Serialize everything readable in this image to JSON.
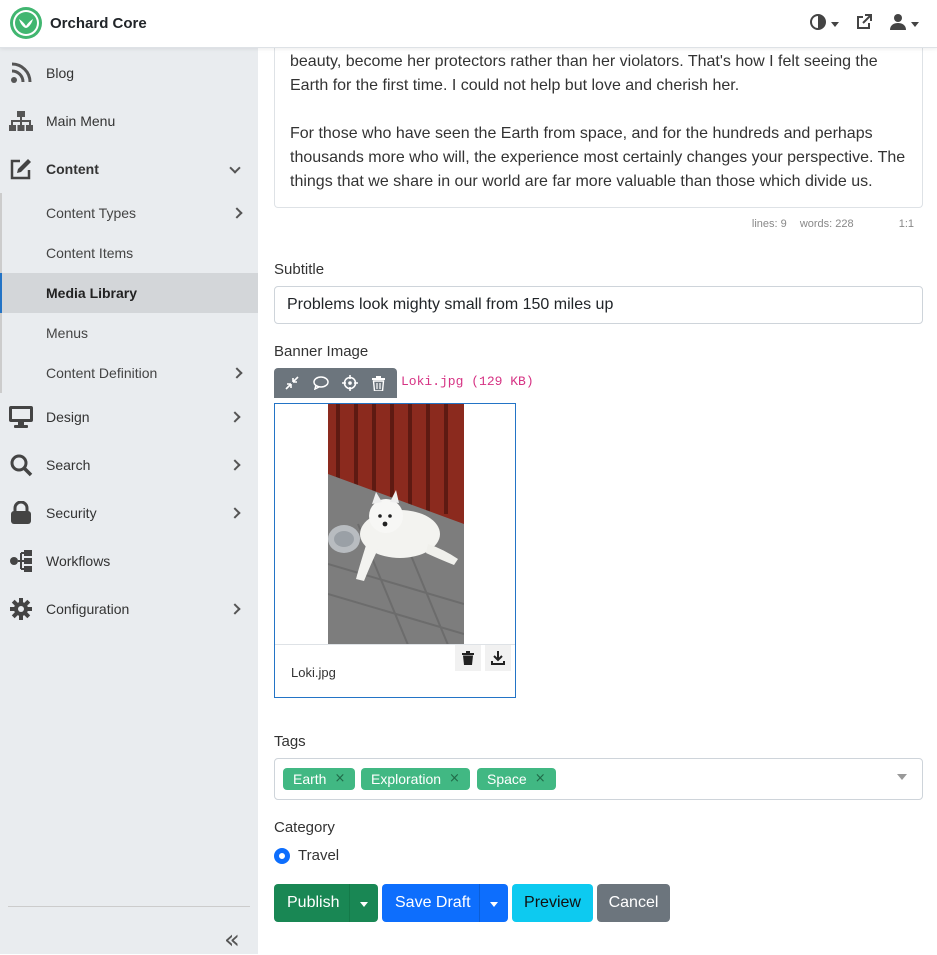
{
  "app": {
    "title": "Orchard Core"
  },
  "sidebar": {
    "items": [
      {
        "label": "Blog"
      },
      {
        "label": "Main Menu"
      },
      {
        "label": "Content"
      },
      {
        "label": "Design"
      },
      {
        "label": "Search"
      },
      {
        "label": "Security"
      },
      {
        "label": "Workflows"
      },
      {
        "label": "Configuration"
      }
    ],
    "content_sub": [
      {
        "label": "Content Types"
      },
      {
        "label": "Content Items"
      },
      {
        "label": "Media Library"
      },
      {
        "label": "Menus"
      },
      {
        "label": "Content Definition"
      }
    ],
    "collapse_glyph": "«"
  },
  "editor": {
    "para1": "beauty, become her protectors rather than her violators. That's how I felt seeing the Earth for the first time. I could not help but love and cherish her.",
    "para2": "For those who have seen the Earth from space, and for the hundreds and perhaps thousands more who will, the experience most certainly changes your perspective. The things that we share in our world are far more valuable than those which divide us.",
    "status_lines": "lines: 9",
    "status_words": "words: 228",
    "status_cursor": "1:1"
  },
  "subtitle": {
    "label": "Subtitle",
    "value": "Problems look mighty small from 150 miles up"
  },
  "banner": {
    "label": "Banner Image",
    "file_info": "Loki.jpg (129 KB)",
    "card_name": "Loki.jpg"
  },
  "tags": {
    "label": "Tags",
    "items": [
      "Earth",
      "Exploration",
      "Space"
    ],
    "remove_glyph": "×"
  },
  "category": {
    "label": "Category",
    "option": "Travel"
  },
  "actions": {
    "publish": "Publish",
    "save_draft": "Save Draft",
    "preview": "Preview",
    "cancel": "Cancel"
  },
  "colors": {
    "accent": "#41b670",
    "publish": "#198754",
    "save": "#0d6efd",
    "preview": "#0dcaf0",
    "cancel": "#6c757d",
    "tag": "#41b883"
  }
}
